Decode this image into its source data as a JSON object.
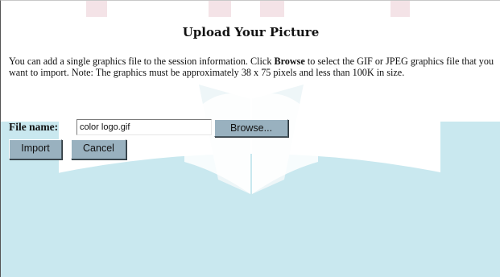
{
  "page": {
    "title": "Upload Your Picture",
    "description_part1": "You can add a single graphics file to the session information. Click ",
    "description_bold": "Browse",
    "description_part2": " to select the GIF or JPEG graphics file that you want to import. Note: The graphics must be approximately 38 x 75 pixels and less than 100K in size."
  },
  "form": {
    "file_label": "File name:",
    "file_value": "color logo.gif",
    "browse_label": "Browse...",
    "import_label": "Import",
    "cancel_label": "Cancel"
  },
  "colors": {
    "button_bg": "#99b1bf",
    "watermark_primary": "#c7e6ee",
    "watermark_secondary": "#f2dde2"
  }
}
